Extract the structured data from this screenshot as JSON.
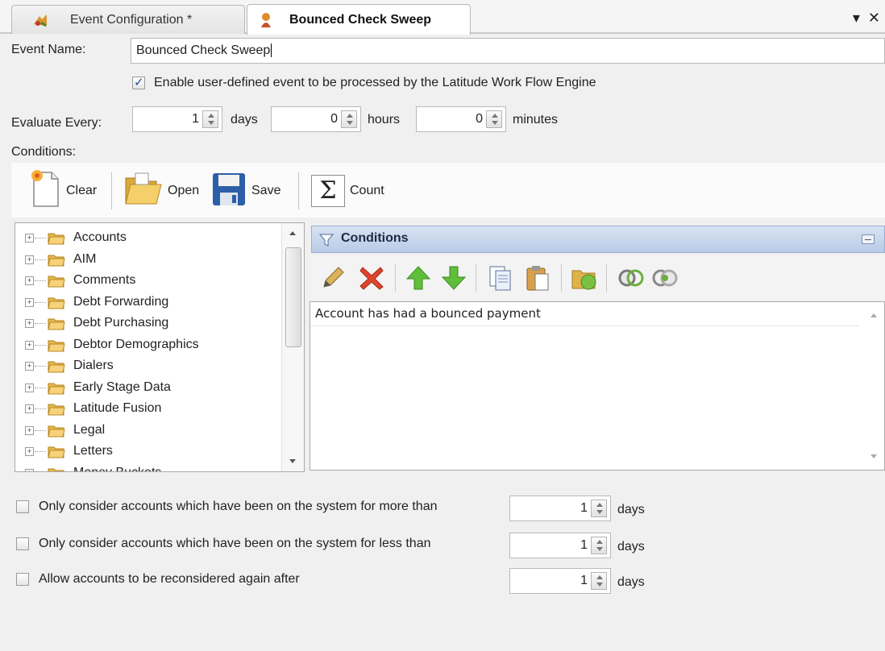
{
  "tabs": [
    {
      "label": "Event Configuration *",
      "icon": "event-config-icon"
    },
    {
      "label": "Bounced Check Sweep",
      "icon": "event-icon"
    }
  ],
  "window_controls": {
    "dropdown": "▾",
    "close": "✕"
  },
  "form": {
    "event_name_label": "Event Name:",
    "event_name_value": "Bounced Check Sweep",
    "enable_label": "Enable user-defined event to be processed by the Latitude Work Flow Engine",
    "enable_checked": true,
    "evaluate_label": "Evaluate Every:",
    "days_value": "1",
    "days_label": "days",
    "hours_value": "0",
    "hours_label": "hours",
    "minutes_value": "0",
    "minutes_label": "minutes",
    "conditions_label": "Conditions:"
  },
  "toolbar": {
    "clear": "Clear",
    "open": "Open",
    "save": "Save",
    "count": "Count"
  },
  "tree": {
    "items": [
      "Accounts",
      "AIM",
      "Comments",
      "Debt Forwarding",
      "Debt Purchasing",
      "Debtor Demographics",
      "Dialers",
      "Early Stage Data",
      "Latitude Fusion",
      "Legal",
      "Letters",
      "Money Buckets"
    ]
  },
  "conditions_panel": {
    "title": "Conditions",
    "rows": [
      "Account has had a bounced payment"
    ]
  },
  "options": [
    {
      "label": "Only consider accounts which have been on the system for more than",
      "value": "1",
      "unit": "days",
      "checked": false
    },
    {
      "label": "Only consider accounts which have been on the system for less than",
      "value": "1",
      "unit": "days",
      "checked": false
    },
    {
      "label": "Allow accounts to be reconsidered again after",
      "value": "1",
      "unit": "days",
      "checked": false
    }
  ],
  "colors": {
    "accent": "#b9cbe6",
    "background": "#f0f0f0"
  }
}
